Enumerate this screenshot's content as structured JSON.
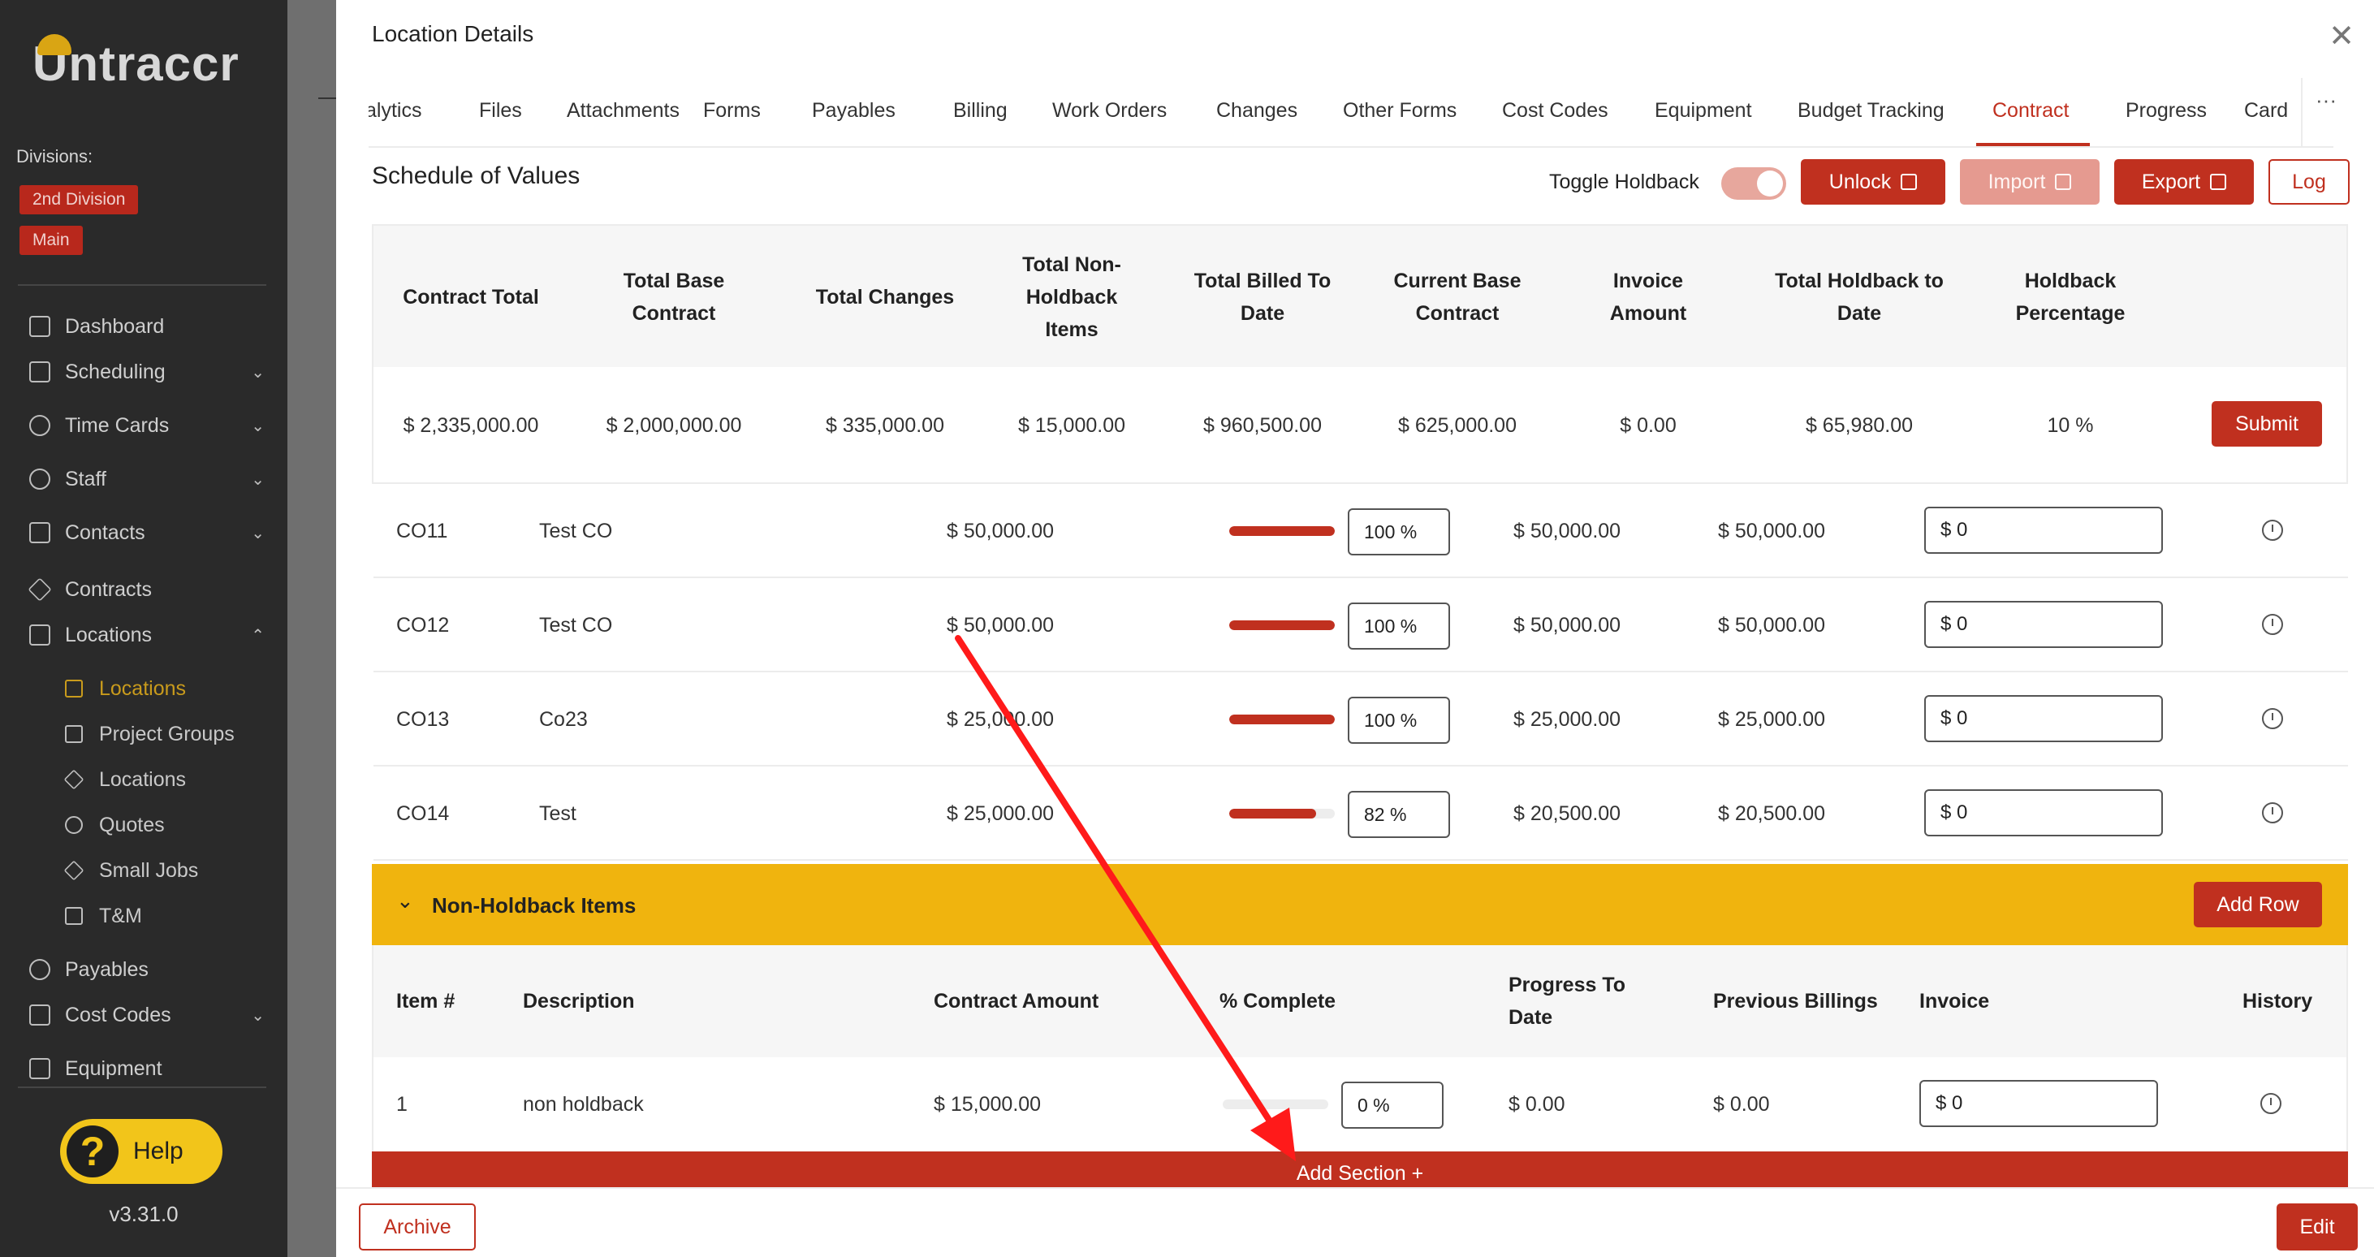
{
  "sidebar": {
    "logo": "Untraccr",
    "divisions_label": "Divisions:",
    "divisions": [
      "2nd Division",
      "Main"
    ],
    "nav": [
      "Dashboard",
      "Scheduling",
      "Time Cards",
      "Staff",
      "Contacts",
      "Contracts",
      "Locations"
    ],
    "sub_nav": [
      "Locations",
      "Project Groups",
      "Locations",
      "Quotes",
      "Small Jobs",
      "T&M"
    ],
    "nav_after": [
      "Payables",
      "Cost Codes",
      "Equipment"
    ],
    "help": "Help",
    "version": "v3.31.0"
  },
  "modal": {
    "title": "Location Details",
    "tabs": [
      "alytics",
      "Files",
      "Attachments",
      "Forms",
      "Payables",
      "Billing",
      "Work Orders",
      "Changes",
      "Other Forms",
      "Cost Codes",
      "Equipment",
      "Budget Tracking",
      "Contract",
      "Progress",
      "Card"
    ],
    "tabs_more": "···",
    "active_tab": "Contract"
  },
  "sov": {
    "title": "Schedule of Values",
    "toggle_label": "Toggle Holdback",
    "unlock": "Unlock",
    "import": "Import",
    "export": "Export",
    "log": "Log"
  },
  "summary": {
    "headers": [
      "Contract Total",
      "Total Base Contract",
      "Total Changes",
      "Total Non-Holdback Items",
      "Total Billed To Date",
      "Current Base Contract",
      "Invoice Amount",
      "Total Holdback to Date",
      "Holdback Percentage"
    ],
    "values": [
      "$ 2,335,000.00",
      "$ 2,000,000.00",
      "$ 335,000.00",
      "$ 15,000.00",
      "$ 960,500.00",
      "$ 625,000.00",
      "$ 0.00",
      "$ 65,980.00",
      "10 %"
    ],
    "submit": "Submit"
  },
  "co_rows": [
    {
      "item": "CO11",
      "desc": "Test CO",
      "amount": "$ 50,000.00",
      "pct": "100 %",
      "pct_value": 100,
      "progress": "$ 50,000.00",
      "previous": "$ 50,000.00",
      "invoice": "$ 0"
    },
    {
      "item": "CO12",
      "desc": "Test CO",
      "amount": "$ 50,000.00",
      "pct": "100 %",
      "pct_value": 100,
      "progress": "$ 50,000.00",
      "previous": "$ 50,000.00",
      "invoice": "$ 0"
    },
    {
      "item": "CO13",
      "desc": "Co23",
      "amount": "$ 25,000.00",
      "pct": "100 %",
      "pct_value": 100,
      "progress": "$ 25,000.00",
      "previous": "$ 25,000.00",
      "invoice": "$ 0"
    },
    {
      "item": "CO14",
      "desc": "Test",
      "amount": "$ 25,000.00",
      "pct": "82 %",
      "pct_value": 82,
      "progress": "$ 20,500.00",
      "previous": "$ 20,500.00",
      "invoice": "$ 0"
    }
  ],
  "non_holdback": {
    "title": "Non-Holdback Items",
    "add_row": "Add Row",
    "headers": [
      "Item #",
      "Description",
      "Contract Amount",
      "% Complete",
      "Progress To Date",
      "Previous Billings",
      "Invoice",
      "History"
    ],
    "row": {
      "item": "1",
      "desc": "non holdback",
      "amount": "$ 15,000.00",
      "pct": "0 %",
      "pct_value": 0,
      "progress": "$ 0.00",
      "previous": "$ 0.00",
      "invoice": "$ 0"
    }
  },
  "add_section": "Add Section  +",
  "footer": {
    "archive": "Archive",
    "edit": "Edit"
  },
  "colors": {
    "accent": "#c0301f",
    "section": "#f0b40e",
    "sidebar": "#2a2a2a",
    "logo_gold": "#d9a514"
  }
}
